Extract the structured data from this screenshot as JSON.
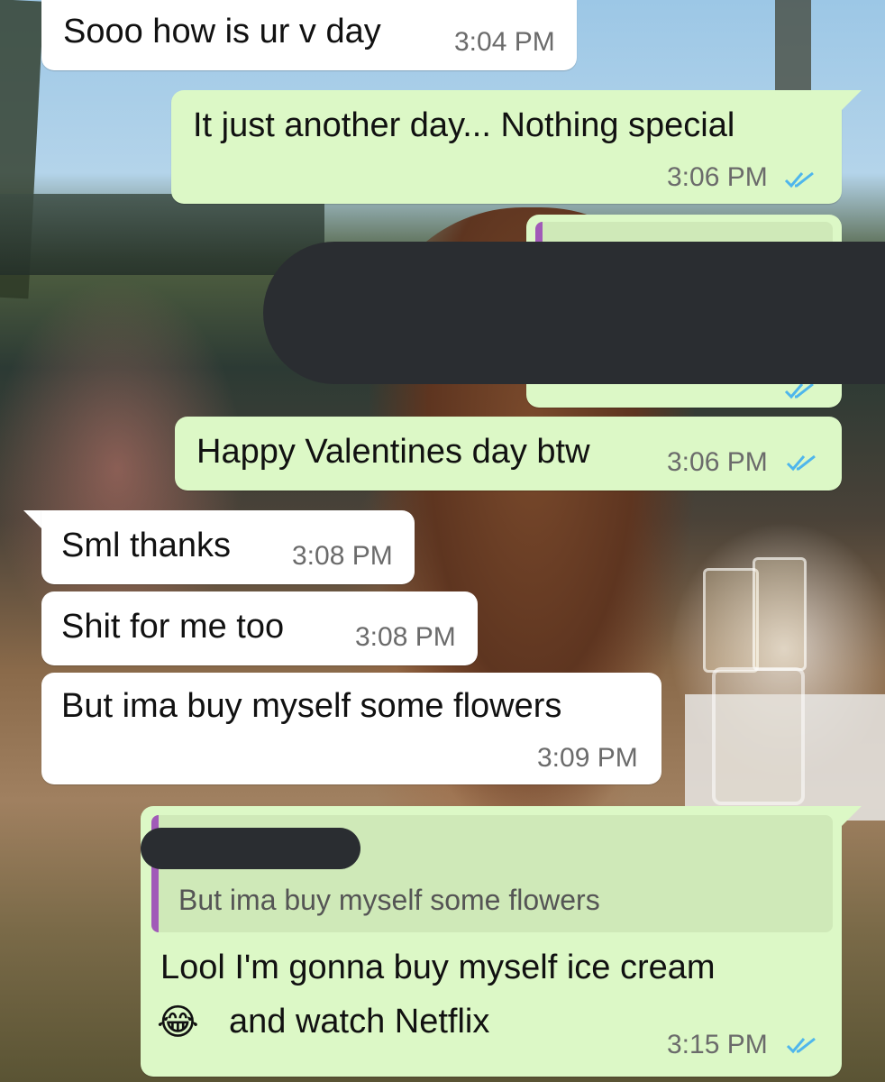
{
  "chat": {
    "colors": {
      "incoming_bubble": "#ffffff",
      "outgoing_bubble": "#dcf8c6",
      "read_ticks": "#4fb6ec",
      "reply_bar": "#a15ab8",
      "redaction": "#2a2d31"
    },
    "messages": [
      {
        "direction": "incoming",
        "text": "Sooo how is ur v day",
        "time": "3:04 PM"
      },
      {
        "direction": "outgoing",
        "text": "It just another day... Nothing special",
        "time": "3:06 PM",
        "status": "read-double-check-icon"
      },
      {
        "direction": "outgoing",
        "text": "",
        "time": "",
        "status": "read-double-check-icon",
        "redacted": true
      },
      {
        "direction": "outgoing",
        "text": "Happy Valentines day btw",
        "time": "3:06 PM",
        "status": "read-double-check-icon"
      },
      {
        "direction": "incoming",
        "text": "Sml thanks",
        "time": "3:08 PM"
      },
      {
        "direction": "incoming",
        "text": "Shit for me too",
        "time": "3:08 PM"
      },
      {
        "direction": "incoming",
        "text": "But ima buy myself some flowers",
        "time": "3:09 PM"
      },
      {
        "direction": "outgoing",
        "reply_to": {
          "author": "",
          "author_redacted": true,
          "text": "But ima buy myself some flowers"
        },
        "text_line1": "Lool I'm gonna buy myself ice cream",
        "emoji": "😂",
        "emoji_name": "face-with-tears-of-joy-icon",
        "text_line2": "and watch Netflix",
        "time": "3:15 PM",
        "status": "read-double-check-icon"
      }
    ]
  }
}
